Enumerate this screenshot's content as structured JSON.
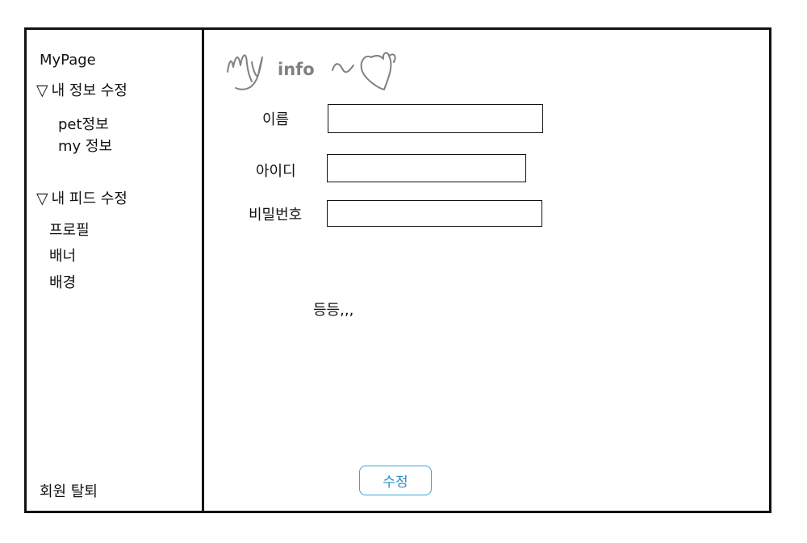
{
  "sidebar": {
    "title": "MyPage",
    "info_section": {
      "toggle": "▽",
      "label": "내 정보 수정",
      "items": [
        "pet정보",
        "my 정보"
      ]
    },
    "feed_section": {
      "toggle": "▽",
      "label": "내 피드 수정",
      "items": [
        "프로필",
        "배너",
        "배경"
      ]
    },
    "withdraw": "회원 탈퇴"
  },
  "main": {
    "logo_text": "info",
    "fields": [
      {
        "label": "이름",
        "value": ""
      },
      {
        "label": "아이디",
        "value": ""
      },
      {
        "label": "비밀번호",
        "value": ""
      }
    ],
    "etc": "등등,,,",
    "submit_label": "수정"
  },
  "colors": {
    "border": "#111111",
    "button_border": "#3aa5d8",
    "button_text": "#2a8fc5",
    "logo_gray": "#808080"
  }
}
